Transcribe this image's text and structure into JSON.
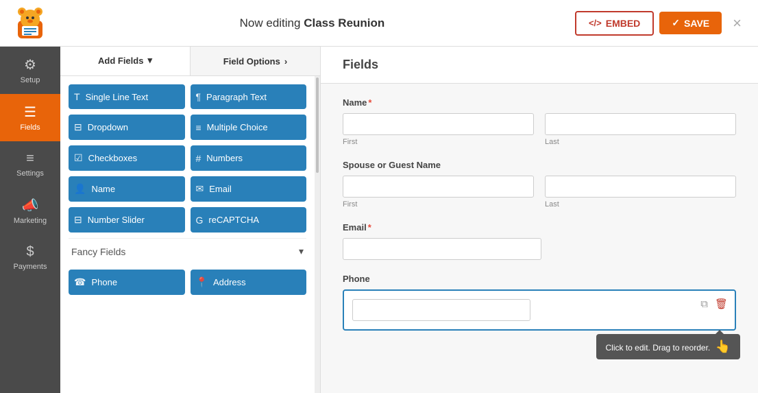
{
  "topbar": {
    "title_prefix": "Now editing ",
    "title_bold": "Class Reunion",
    "embed_label": "EMBED",
    "save_label": "SAVE",
    "close_label": "×"
  },
  "sidebar": {
    "items": [
      {
        "id": "setup",
        "label": "Setup",
        "icon": "⚙"
      },
      {
        "id": "fields",
        "label": "Fields",
        "icon": "☰",
        "active": true
      },
      {
        "id": "settings",
        "label": "Settings",
        "icon": "≡"
      },
      {
        "id": "marketing",
        "label": "Marketing",
        "icon": "📣"
      },
      {
        "id": "payments",
        "label": "Payments",
        "icon": "$"
      }
    ]
  },
  "panel": {
    "add_fields_label": "Add Fields",
    "field_options_label": "Field Options",
    "field_options_arrow": "›",
    "fields": [
      {
        "id": "single-line-text",
        "label": "Single Line Text",
        "icon": "T"
      },
      {
        "id": "paragraph-text",
        "label": "Paragraph Text",
        "icon": "¶"
      },
      {
        "id": "dropdown",
        "label": "Dropdown",
        "icon": "⊟"
      },
      {
        "id": "multiple-choice",
        "label": "Multiple Choice",
        "icon": "≡"
      },
      {
        "id": "checkboxes",
        "label": "Checkboxes",
        "icon": "☑"
      },
      {
        "id": "numbers",
        "label": "Numbers",
        "icon": "#"
      },
      {
        "id": "name",
        "label": "Name",
        "icon": "👤"
      },
      {
        "id": "email",
        "label": "Email",
        "icon": "✉"
      },
      {
        "id": "number-slider",
        "label": "Number Slider",
        "icon": "⊟"
      },
      {
        "id": "recaptcha",
        "label": "reCAPTCHA",
        "icon": "G"
      }
    ],
    "fancy_fields_label": "Fancy Fields",
    "fancy_fields": [
      {
        "id": "phone",
        "label": "Phone",
        "icon": "☎"
      },
      {
        "id": "address",
        "label": "Address",
        "icon": "📍"
      }
    ]
  },
  "form": {
    "title": "Fields",
    "fields": [
      {
        "id": "name-field",
        "label": "Name",
        "required": true,
        "type": "name",
        "sub_fields": [
          {
            "placeholder": "",
            "sub_label": "First"
          },
          {
            "placeholder": "",
            "sub_label": "Last"
          }
        ]
      },
      {
        "id": "spouse-name-field",
        "label": "Spouse or Guest Name",
        "required": false,
        "type": "name",
        "sub_fields": [
          {
            "placeholder": "",
            "sub_label": "First"
          },
          {
            "placeholder": "",
            "sub_label": "Last"
          }
        ]
      },
      {
        "id": "email-field",
        "label": "Email",
        "required": true,
        "type": "email"
      },
      {
        "id": "phone-field",
        "label": "Phone",
        "required": false,
        "type": "phone",
        "active": true
      }
    ],
    "tooltip_text": "Click to edit. Drag to reorder.",
    "copy_icon": "⧉",
    "delete_icon": "🗑"
  }
}
